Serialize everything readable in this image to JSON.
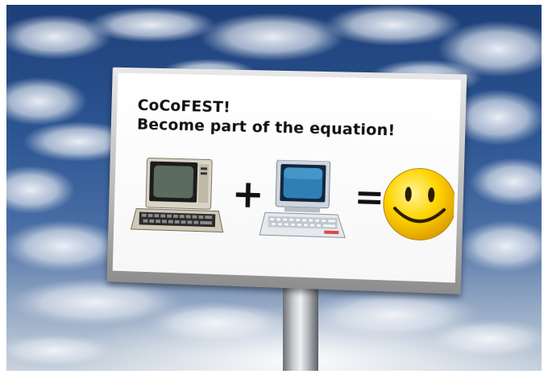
{
  "billboard": {
    "title_line1": "CoCoFEST!",
    "title_line2": "Become part of the equation!"
  },
  "equation": {
    "left_icon": "vintage-computer-icon",
    "operator_plus": "+",
    "middle_icon": "retro-computer-icon",
    "operator_equals": "=",
    "result_icon": "smiley-face-icon"
  },
  "colors": {
    "sky_dark": "#1d3f78",
    "smiley_yellow": "#ffd400",
    "board_white": "#ffffff"
  }
}
